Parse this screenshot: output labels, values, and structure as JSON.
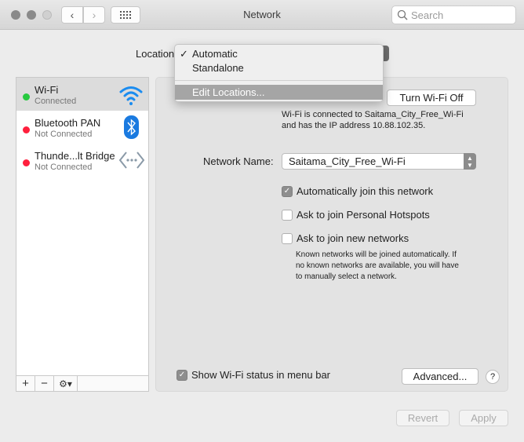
{
  "window": {
    "title": "Network",
    "search_placeholder": "Search"
  },
  "location": {
    "label": "Location:",
    "menu_items": [
      {
        "label": "Automatic",
        "checked": true
      },
      {
        "label": "Standalone",
        "checked": false
      },
      {
        "label": "Edit Locations...",
        "highlighted": true
      }
    ],
    "check": "✓"
  },
  "services": [
    {
      "name": "Wi-Fi",
      "status": "Connected",
      "status_color": "#27c93f",
      "icon": "wifi-icon"
    },
    {
      "name": "Bluetooth PAN",
      "status": "Not Connected",
      "status_color": "#ff1f3d",
      "icon": "bluetooth-icon"
    },
    {
      "name": "Thunde...lt Bridge",
      "status": "Not Connected",
      "status_color": "#ff1f3d",
      "icon": "ethernet-bridge-icon"
    }
  ],
  "sidebar_toolbar": {
    "add": "+",
    "remove": "−",
    "gear": "⚙▾"
  },
  "panel": {
    "turn_off_label": "Turn Wi-Fi Off",
    "status_line1": "Wi-Fi is connected to Saitama_City_Free_Wi-Fi",
    "status_line2": "and has the IP address 10.88.102.35.",
    "network_name_label": "Network Name:",
    "network_name_value": "Saitama_City_Free_Wi-Fi",
    "auto_join": {
      "label": "Automatically join this network",
      "checked": true
    },
    "ask_hotspots": {
      "label": "Ask to join Personal Hotspots",
      "checked": false
    },
    "ask_new": {
      "label": "Ask to join new networks",
      "checked": false
    },
    "note_line1": "Known networks will be joined automatically. If",
    "note_line2": "no known networks are available, you will have",
    "note_line3": "to manually select a network.",
    "show_status": {
      "label": "Show Wi-Fi status in menu bar",
      "checked": true
    },
    "advanced_label": "Advanced...",
    "help_label": "?"
  },
  "footer": {
    "revert_label": "Revert",
    "apply_label": "Apply"
  }
}
